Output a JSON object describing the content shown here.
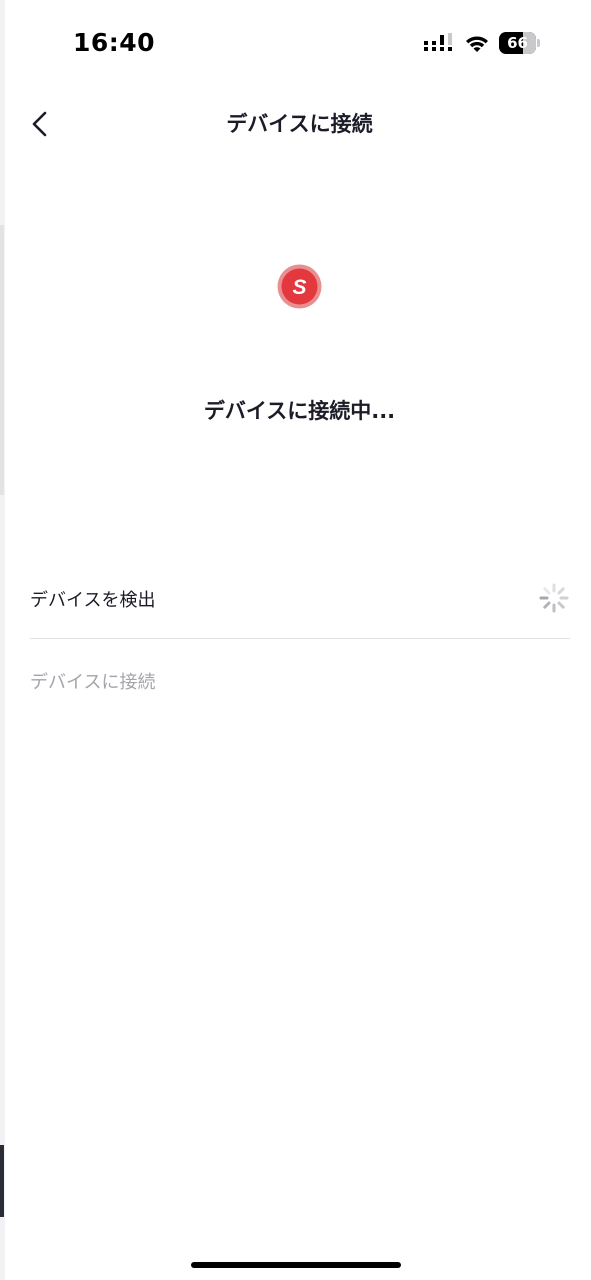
{
  "status_bar": {
    "time": "16:40",
    "battery_level": "66",
    "icons": [
      "signal-icon",
      "wifi-icon",
      "battery-icon"
    ]
  },
  "header": {
    "title": "デバイスに接続",
    "back_icon": "chevron-left-icon"
  },
  "brand": {
    "logo_letter": "S",
    "logo_color": "#e2383e"
  },
  "main": {
    "connecting_text": "デバイスに接続中..."
  },
  "steps": [
    {
      "label": "デバイスを検出",
      "state": "in-progress",
      "icon": "spinner-icon"
    },
    {
      "label": "デバイスに接続",
      "state": "pending"
    }
  ],
  "colors": {
    "text_primary": "#1c1c28",
    "text_disabled": "#a4a4ab",
    "divider": "#e2e2e6",
    "accent": "#e2383e"
  }
}
